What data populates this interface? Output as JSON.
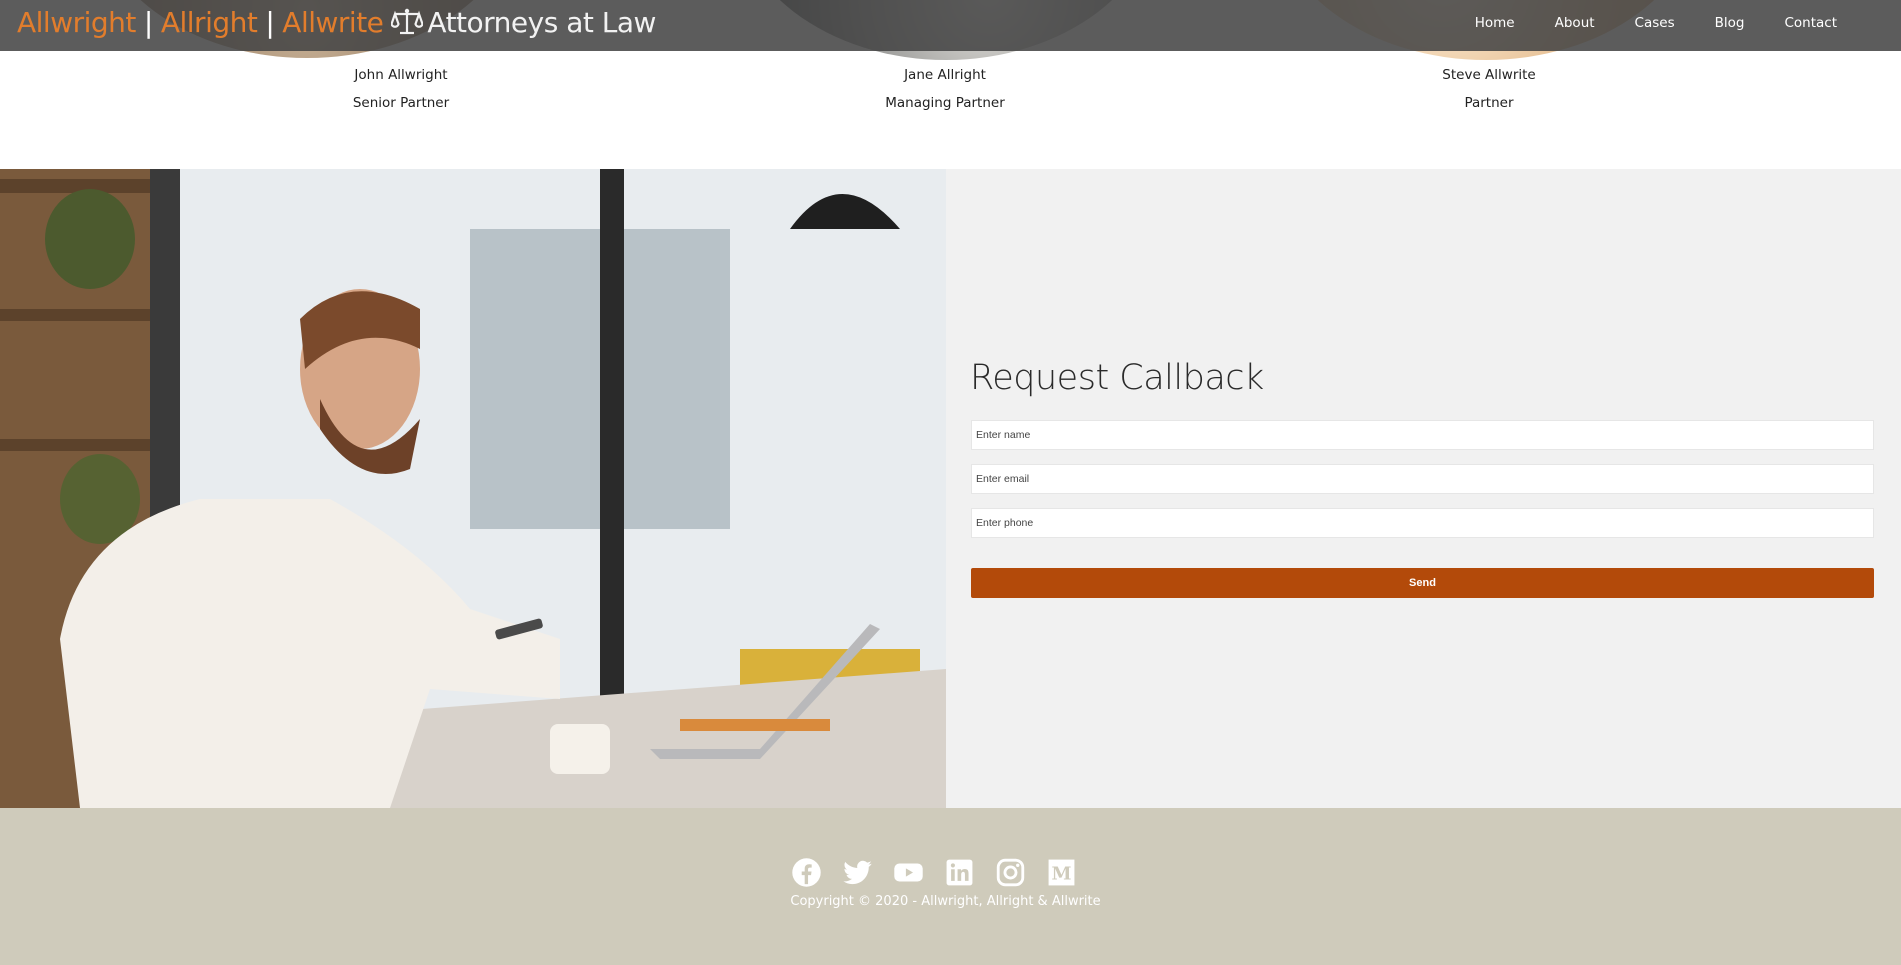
{
  "header": {
    "brand_names": [
      "Allwright",
      "Allright",
      "Allwrite"
    ],
    "separator": "|",
    "tagline": "Attorneys at Law",
    "brand_color": "#e27d2c",
    "nav": [
      "Home",
      "About",
      "Cases",
      "Blog",
      "Contact"
    ]
  },
  "partners": [
    {
      "name": "John Allwright",
      "role": "Senior Partner"
    },
    {
      "name": "Jane Allright",
      "role": "Managing Partner"
    },
    {
      "name": "Steve Allwrite",
      "role": "Partner"
    }
  ],
  "callback": {
    "title": "Request Callback",
    "name_placeholder": "Enter name",
    "email_placeholder": "Enter email",
    "phone_placeholder": "Enter phone",
    "send_label": "Send",
    "send_color": "#b34a0a"
  },
  "footer": {
    "social_icons": [
      "facebook-icon",
      "twitter-icon",
      "youtube-icon",
      "linkedin-icon",
      "instagram-icon",
      "medium-icon"
    ],
    "copyright": "Copyright © 2020 - Allwright, Allright & Allwrite"
  }
}
